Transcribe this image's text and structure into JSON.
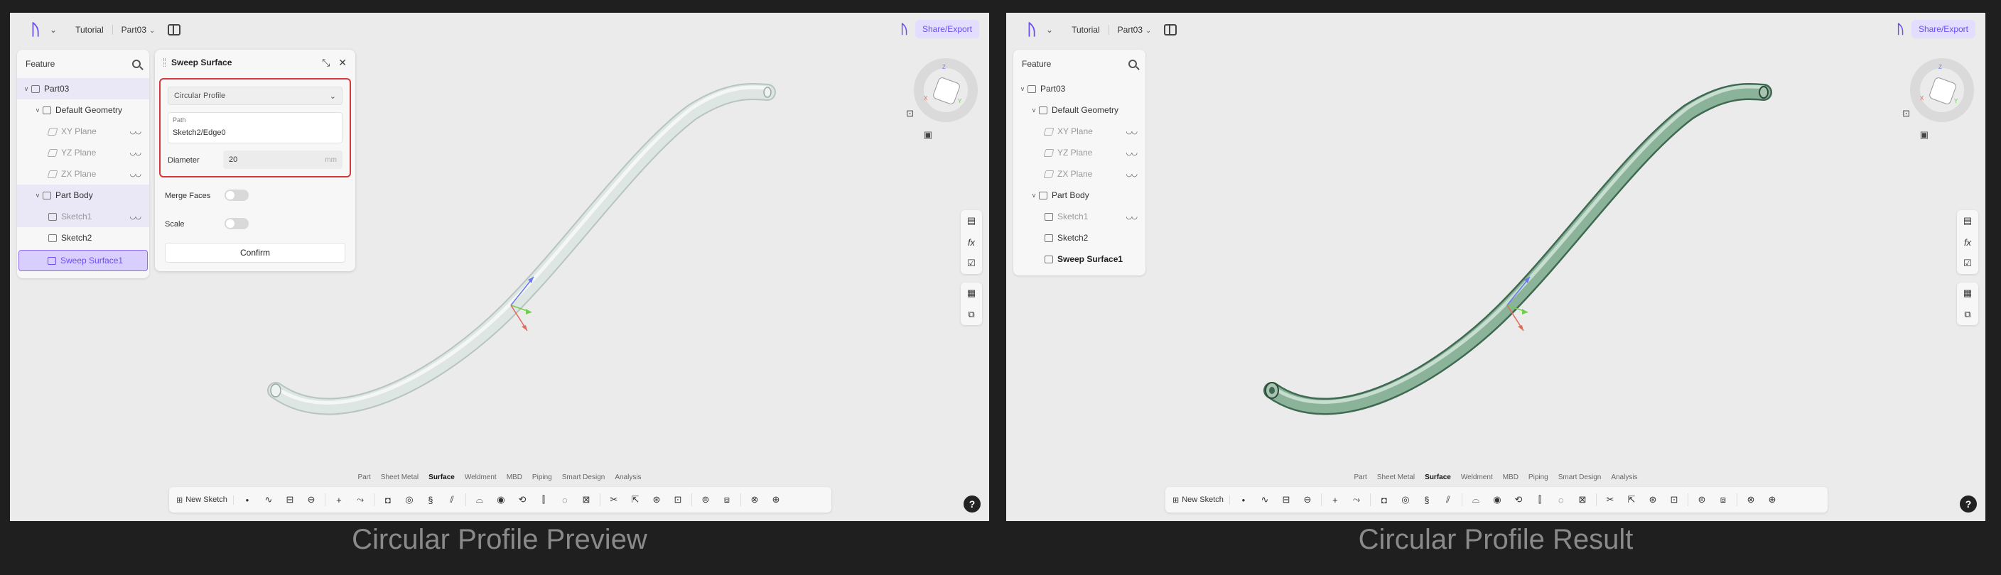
{
  "colors": {
    "accent": "#6b4cf6",
    "highlight_box": "#d6373a",
    "preview_tube": "#dde6e2",
    "result_tube": "#8bb39a"
  },
  "panels": [
    {
      "topbar": {
        "breadcrumb_1": "Tutorial",
        "breadcrumb_2": "Part03"
      },
      "share_label": "Share/Export",
      "feature": {
        "title": "Feature",
        "rows": [
          "Part03",
          "Default Geometry",
          "XY Plane",
          "YZ Plane",
          "ZX Plane",
          "Part Body",
          "Sketch1",
          "Sketch2",
          "Sweep Surface1"
        ]
      },
      "caption": "Circular Profile  Preview"
    },
    {
      "topbar": {
        "breadcrumb_1": "Tutorial",
        "breadcrumb_2": "Part03"
      },
      "share_label": "Share/Export",
      "feature": {
        "title": "Feature",
        "rows": [
          "Part03",
          "Default Geometry",
          "XY Plane",
          "YZ Plane",
          "ZX Plane",
          "Part Body",
          "Sketch1",
          "Sketch2",
          "Sweep Surface1"
        ]
      },
      "caption": "Circular Profile  Result"
    }
  ],
  "dialog": {
    "title": "Sweep Surface",
    "profile_type": "Circular Profile",
    "path_label": "Path",
    "path_value": "Sketch2/Edge0",
    "diameter_label": "Diameter",
    "diameter_value": "20",
    "diameter_unit": "mm",
    "merge_faces_label": "Merge Faces",
    "scale_label": "Scale",
    "confirm_label": "Confirm"
  },
  "bottom_tabs": [
    "Part",
    "Sheet Metal",
    "Surface",
    "Weldment",
    "MBD",
    "Piping",
    "Smart Design",
    "Analysis"
  ],
  "active_tab": "Surface",
  "toolbar": {
    "new_sketch": "New Sketch"
  },
  "viewcube": {
    "axis_z": "Z",
    "axis_x": "X",
    "axis_y": "Y"
  },
  "help": "?"
}
